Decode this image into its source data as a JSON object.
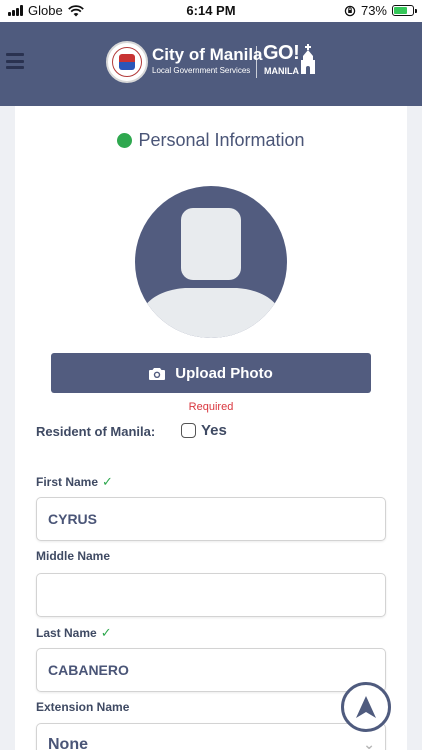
{
  "status_bar": {
    "carrier": "Globe",
    "time": "6:14 PM",
    "battery": "73%",
    "battery_level": 0.73
  },
  "header": {
    "brand_title": "City of Manila",
    "brand_subtitle": "Local Government Services",
    "go_label": "GO!",
    "go_sub": "MANILA",
    "menu_icon": "hamburger-icon",
    "logo": "city-seal-icon"
  },
  "section": {
    "title": "Personal Information",
    "status_color": "#2fa84f"
  },
  "photo": {
    "upload_label": "Upload Photo",
    "required_text": "Required"
  },
  "resident": {
    "label": "Resident of Manila:",
    "option_label": "Yes",
    "checked": false
  },
  "form": {
    "first_name_label": "First Name",
    "first_name_value": "CYRUS",
    "middle_name_label": "Middle Name",
    "middle_name_value": "",
    "last_name_label": "Last Name",
    "last_name_value": "CABANERO",
    "extension_label": "Extension Name",
    "extension_value": "None"
  },
  "colors": {
    "header_bg": "#4f5b7e",
    "accent": "#525c7f",
    "valid_green": "#2fa84f",
    "required_red": "#d9363e"
  }
}
